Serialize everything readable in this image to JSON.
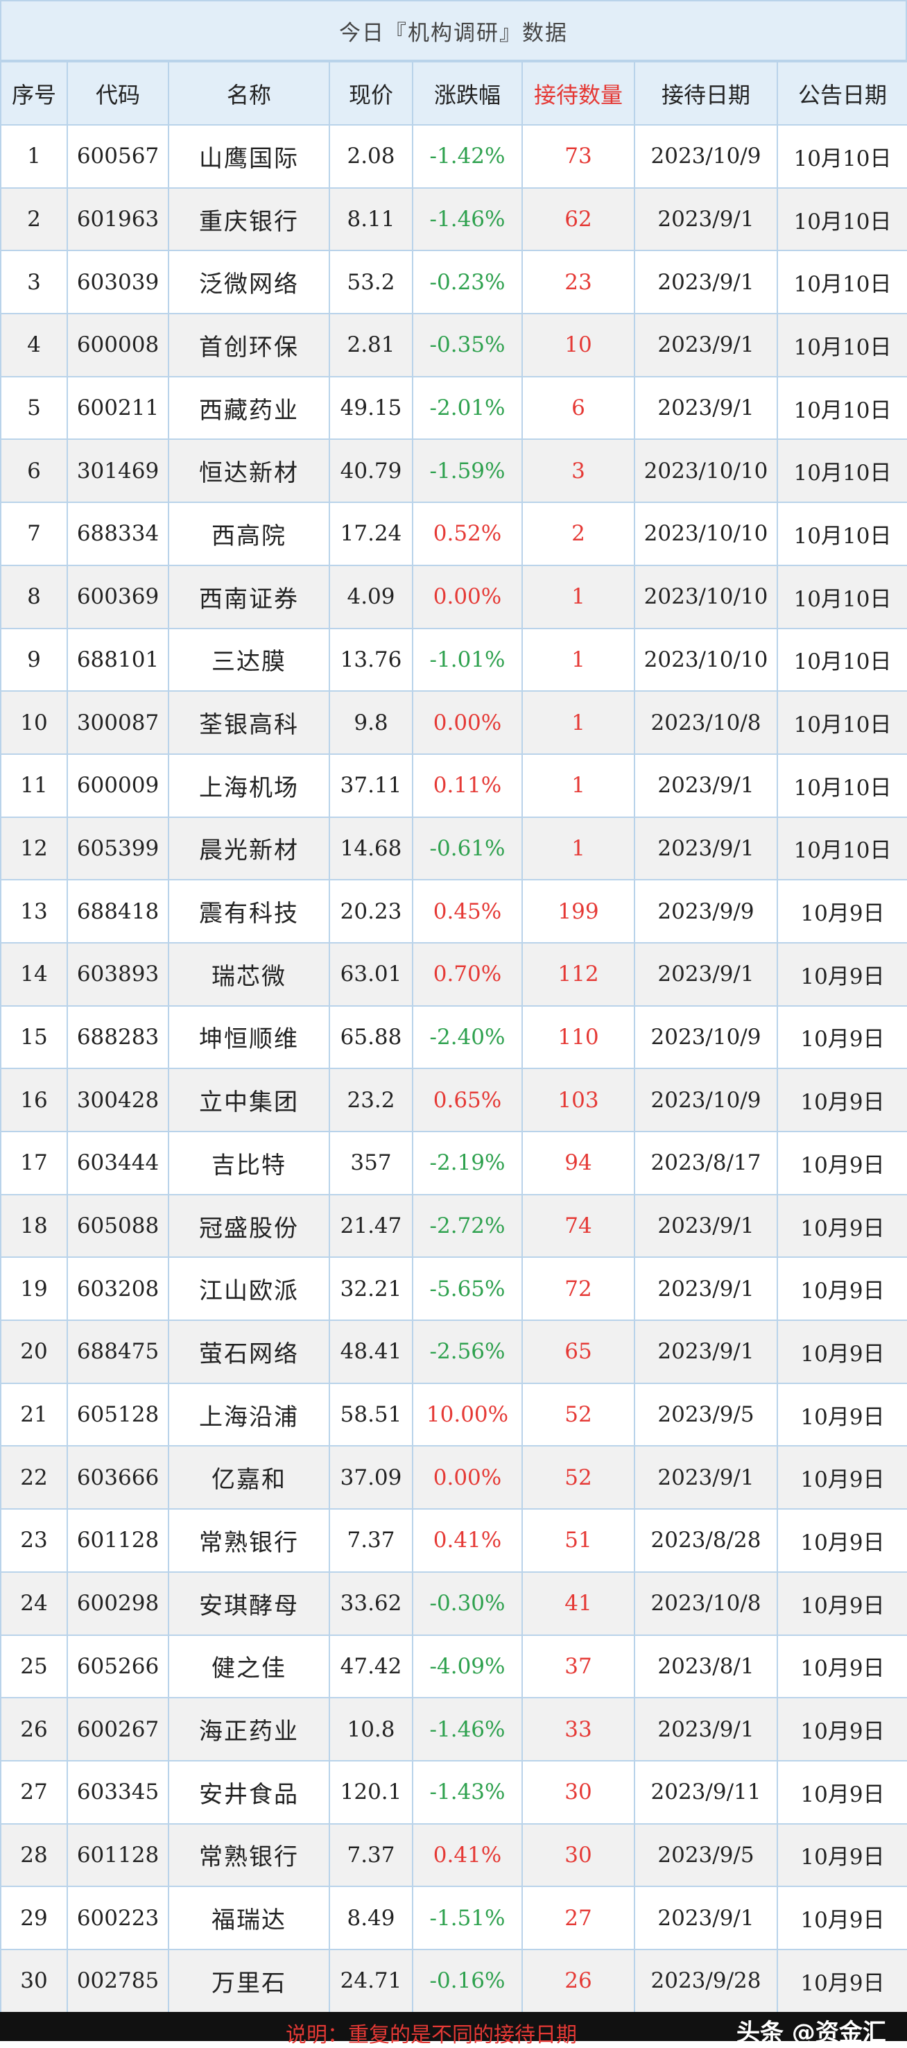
{
  "title": "今日『机构调研』数据",
  "headers": [
    "序号",
    "代码",
    "名称",
    "现价",
    "涨跌幅",
    "接待数量",
    "接待日期",
    "公告日期"
  ],
  "rows": [
    [
      "1",
      "600567",
      "山鹰国际",
      "2.08",
      "-1.42%",
      "73",
      "2023/10/9",
      "10月10日"
    ],
    [
      "2",
      "601963",
      "重庆银行",
      "8.11",
      "-1.46%",
      "62",
      "2023/9/1",
      "10月10日"
    ],
    [
      "3",
      "603039",
      "泛微网络",
      "53.2",
      "-0.23%",
      "23",
      "2023/9/1",
      "10月10日"
    ],
    [
      "4",
      "600008",
      "首创环保",
      "2.81",
      "-0.35%",
      "10",
      "2023/9/1",
      "10月10日"
    ],
    [
      "5",
      "600211",
      "西藏药业",
      "49.15",
      "-2.01%",
      "6",
      "2023/9/1",
      "10月10日"
    ],
    [
      "6",
      "301469",
      "恒达新材",
      "40.79",
      "-1.59%",
      "3",
      "2023/10/10",
      "10月10日"
    ],
    [
      "7",
      "688334",
      "西高院",
      "17.24",
      "0.52%",
      "2",
      "2023/10/10",
      "10月10日"
    ],
    [
      "8",
      "600369",
      "西南证券",
      "4.09",
      "0.00%",
      "1",
      "2023/10/10",
      "10月10日"
    ],
    [
      "9",
      "688101",
      "三达膜",
      "13.76",
      "-1.01%",
      "1",
      "2023/10/10",
      "10月10日"
    ],
    [
      "10",
      "300087",
      "荃银高科",
      "9.8",
      "0.00%",
      "1",
      "2023/10/8",
      "10月10日"
    ],
    [
      "11",
      "600009",
      "上海机场",
      "37.11",
      "0.11%",
      "1",
      "2023/9/1",
      "10月10日"
    ],
    [
      "12",
      "605399",
      "晨光新材",
      "14.68",
      "-0.61%",
      "1",
      "2023/9/1",
      "10月10日"
    ],
    [
      "13",
      "688418",
      "震有科技",
      "20.23",
      "0.45%",
      "199",
      "2023/9/9",
      "10月9日"
    ],
    [
      "14",
      "603893",
      "瑞芯微",
      "63.01",
      "0.70%",
      "112",
      "2023/9/1",
      "10月9日"
    ],
    [
      "15",
      "688283",
      "坤恒顺维",
      "65.88",
      "-2.40%",
      "110",
      "2023/10/9",
      "10月9日"
    ],
    [
      "16",
      "300428",
      "立中集团",
      "23.2",
      "0.65%",
      "103",
      "2023/10/9",
      "10月9日"
    ],
    [
      "17",
      "603444",
      "吉比特",
      "357",
      "-2.19%",
      "94",
      "2023/8/17",
      "10月9日"
    ],
    [
      "18",
      "605088",
      "冠盛股份",
      "21.47",
      "-2.72%",
      "74",
      "2023/9/1",
      "10月9日"
    ],
    [
      "19",
      "603208",
      "江山欧派",
      "32.21",
      "-5.65%",
      "72",
      "2023/9/1",
      "10月9日"
    ],
    [
      "20",
      "688475",
      "萤石网络",
      "48.41",
      "-2.56%",
      "65",
      "2023/9/1",
      "10月9日"
    ],
    [
      "21",
      "605128",
      "上海沿浦",
      "58.51",
      "10.00%",
      "52",
      "2023/9/5",
      "10月9日"
    ],
    [
      "22",
      "603666",
      "亿嘉和",
      "37.09",
      "0.00%",
      "52",
      "2023/9/1",
      "10月9日"
    ],
    [
      "23",
      "601128",
      "常熟银行",
      "7.37",
      "0.41%",
      "51",
      "2023/8/28",
      "10月9日"
    ],
    [
      "24",
      "600298",
      "安琪酵母",
      "33.62",
      "-0.30%",
      "41",
      "2023/10/8",
      "10月9日"
    ],
    [
      "25",
      "605266",
      "健之佳",
      "47.42",
      "-4.09%",
      "37",
      "2023/8/1",
      "10月9日"
    ],
    [
      "26",
      "600267",
      "海正药业",
      "10.8",
      "-1.46%",
      "33",
      "2023/9/1",
      "10月9日"
    ],
    [
      "27",
      "603345",
      "安井食品",
      "120.1",
      "-1.43%",
      "30",
      "2023/9/11",
      "10月9日"
    ],
    [
      "28",
      "601128",
      "常熟银行",
      "7.37",
      "0.41%",
      "30",
      "2023/9/5",
      "10月9日"
    ],
    [
      "29",
      "600223",
      "福瑞达",
      "8.49",
      "-1.51%",
      "27",
      "2023/9/1",
      "10月9日"
    ],
    [
      "30",
      "002785",
      "万里石",
      "24.71",
      "-0.16%",
      "26",
      "2023/9/28",
      "10月9日"
    ]
  ],
  "footer": {
    "note": "说明：重复的是不同的接待日期",
    "brand": "头条 @资金汇"
  },
  "colors": {
    "up": "#e53935",
    "down": "#2ea14e",
    "header_bg": "#e2eef8",
    "border": "#b9d3ea"
  }
}
